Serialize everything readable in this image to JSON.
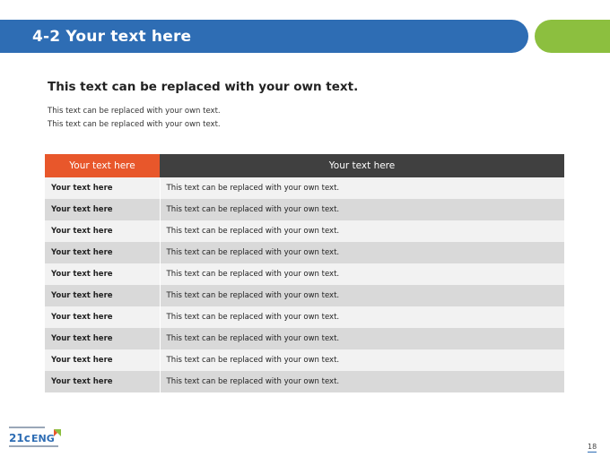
{
  "header": {
    "title": "4-2 Your text here"
  },
  "content": {
    "subtitle": "This text can be replaced with your own text.",
    "desc_line1": "This text can be replaced with your own text.",
    "desc_line2": "This text can be replaced with your own text."
  },
  "table": {
    "headers": [
      "Your text here",
      "Your text here"
    ],
    "rows": [
      [
        "Your text here",
        "This text can be replaced with your own text."
      ],
      [
        "Your text here",
        "This text can be replaced with your own text."
      ],
      [
        "Your text here",
        "This text can be replaced with your own text."
      ],
      [
        "Your text here",
        "This text can be replaced with your own text."
      ],
      [
        "Your text here",
        "This text can be replaced with your own text."
      ],
      [
        "Your text here",
        "This text can be replaced with your own text."
      ],
      [
        "Your text here",
        "This text can be replaced with your own text."
      ],
      [
        "Your text here",
        "This text can be replaced with your own text."
      ],
      [
        "Your text here",
        "This text can be replaced with your own text."
      ],
      [
        "Your text here",
        "This text can be replaced with your own text."
      ]
    ]
  },
  "footer": {
    "logo_text": "21c ENG",
    "page_number": "18"
  },
  "colors": {
    "title_bar": "#2e6db4",
    "accent_green": "#8cbf3f",
    "header_orange": "#e8572b",
    "header_dark": "#404040"
  }
}
